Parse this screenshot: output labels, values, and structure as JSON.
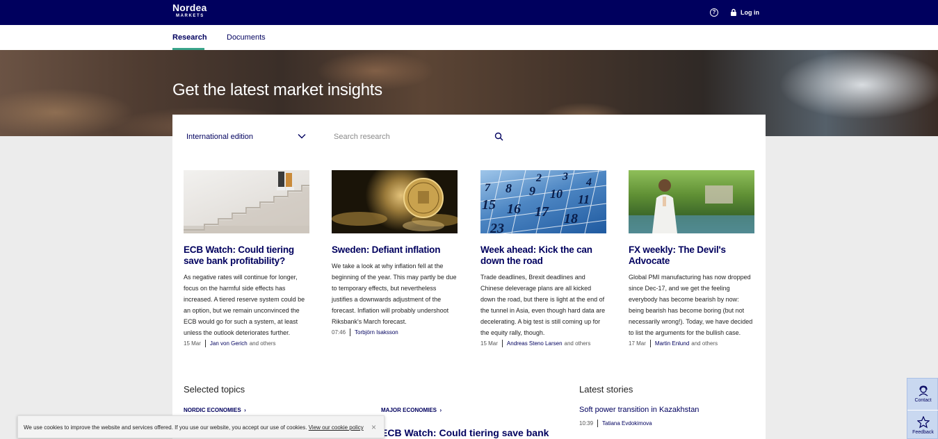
{
  "header": {
    "logo_line1": "Nordea",
    "logo_line2": "MARKETS",
    "help_icon": "?",
    "login_label": "Log in"
  },
  "nav": {
    "tabs": [
      {
        "label": "Research",
        "active": true
      },
      {
        "label": "Documents",
        "active": false
      }
    ]
  },
  "hero": {
    "title": "Get the latest market insights"
  },
  "filters": {
    "edition": "International edition",
    "search_placeholder": "Search research"
  },
  "cards": [
    {
      "title": "ECB Watch: Could tiering save bank profitability?",
      "description": "As negative rates will continue for longer, focus on the harmful side effects has increased. A tiered reserve system could be an option, but we remain unconvinced the ECB would go for such a system, at least unless the outlook deteriorates further.",
      "date": "15 Mar",
      "author": "Jan von Gerich",
      "others": "and others"
    },
    {
      "title": "Sweden: Defiant inflation",
      "description": "We take a look at why inflation fell at the beginning of the year. This may partly be due to temporary effects, but nevertheless justifies a downwards adjustment of the forecast. Inflation will probably undershoot Riksbank's March forecast.",
      "date": "07:46",
      "author": "Torbjörn Isaksson",
      "others": ""
    },
    {
      "title": "Week ahead: Kick the can down the road",
      "description": "Trade deadlines, Brexit deadlines and Chinese deleverage plans are all kicked down the road, but there is light at the end of the tunnel in Asia, even though hard data are decelerating. A big test is still coming up for the equity rally, though.",
      "date": "15 Mar",
      "author": "Andreas Steno Larsen",
      "others": "and others"
    },
    {
      "title": "FX weekly: The Devil's Advocate",
      "description": "Global PMI manufacturing has now dropped since Dec-17, and we get the feeling everybody has become bearish by now: being bearish has become boring (but not necessarily wrong!). Today, we have decided to list the arguments for the bullish case.",
      "date": "17 Mar",
      "author": "Martin Enlund",
      "others": "and others"
    }
  ],
  "calendar_numbers": [
    "2",
    "3",
    "4",
    "7",
    "8",
    "9",
    "10",
    "11",
    "15",
    "16",
    "17",
    "18",
    "23"
  ],
  "selected_topics": {
    "title": "Selected topics",
    "links": [
      "NORDIC ECONOMIES",
      "MAJOR ECONOMIES"
    ],
    "headline": "ECB Watch: Could tiering save bank"
  },
  "latest_stories": {
    "title": "Latest stories",
    "items": [
      {
        "title": "Soft power transition in Kazakhstan",
        "time": "10:39",
        "author": "Tatiana Evdokimova"
      }
    ]
  },
  "cookie": {
    "text": "We use cookies to improve the website and services offered. If you use our website, you accept our use of cookies.",
    "link": "View our cookie policy",
    "close": "×"
  },
  "feedback": {
    "contact": "Contact",
    "feedback": "Feedback"
  },
  "colors": {
    "brand": "#00005e",
    "accent": "#3aa58b"
  }
}
